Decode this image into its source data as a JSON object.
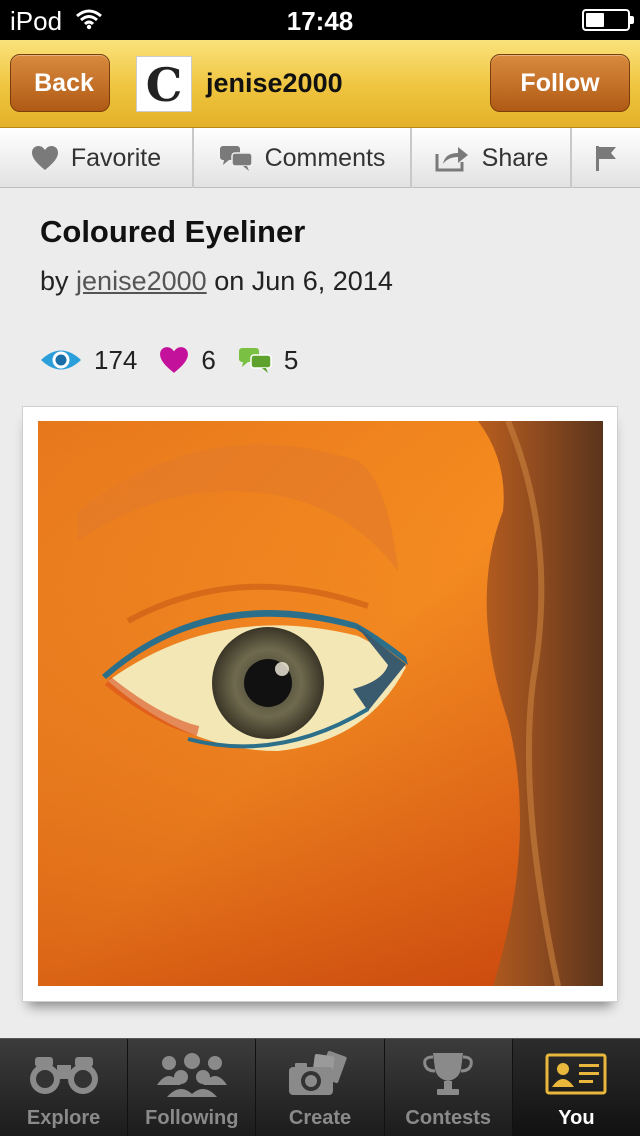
{
  "status_bar": {
    "carrier": "iPod",
    "time": "17:48",
    "battery_level": 0.45
  },
  "nav": {
    "back_label": "Back",
    "avatar_letter": "C",
    "username": "jenise2000",
    "follow_label": "Follow"
  },
  "actions": [
    {
      "label": "Favorite",
      "icon": "heart-icon"
    },
    {
      "label": "Comments",
      "icon": "speech-bubbles-icon"
    },
    {
      "label": "Share",
      "icon": "share-arrow-icon"
    },
    {
      "label": "",
      "icon": "flag-icon"
    }
  ],
  "post": {
    "title": "Coloured Eyeliner",
    "by": "by",
    "author": "jenise2000",
    "date_text": "on Jun 6, 2014"
  },
  "stats": {
    "views": "174",
    "favorites": "6",
    "comments": "5"
  },
  "colors": {
    "accent": "#efc43e",
    "button": "#b05a15",
    "heart": "#c4119b",
    "eye": "#2b9fd9",
    "comment": "#7ac143"
  },
  "tabs": [
    {
      "label": "Explore",
      "icon": "binoculars-icon"
    },
    {
      "label": "Following",
      "icon": "people-icon"
    },
    {
      "label": "Create",
      "icon": "camera-icon"
    },
    {
      "label": "Contests",
      "icon": "trophy-icon"
    },
    {
      "label": "You",
      "icon": "profile-card-icon",
      "active": true
    }
  ]
}
